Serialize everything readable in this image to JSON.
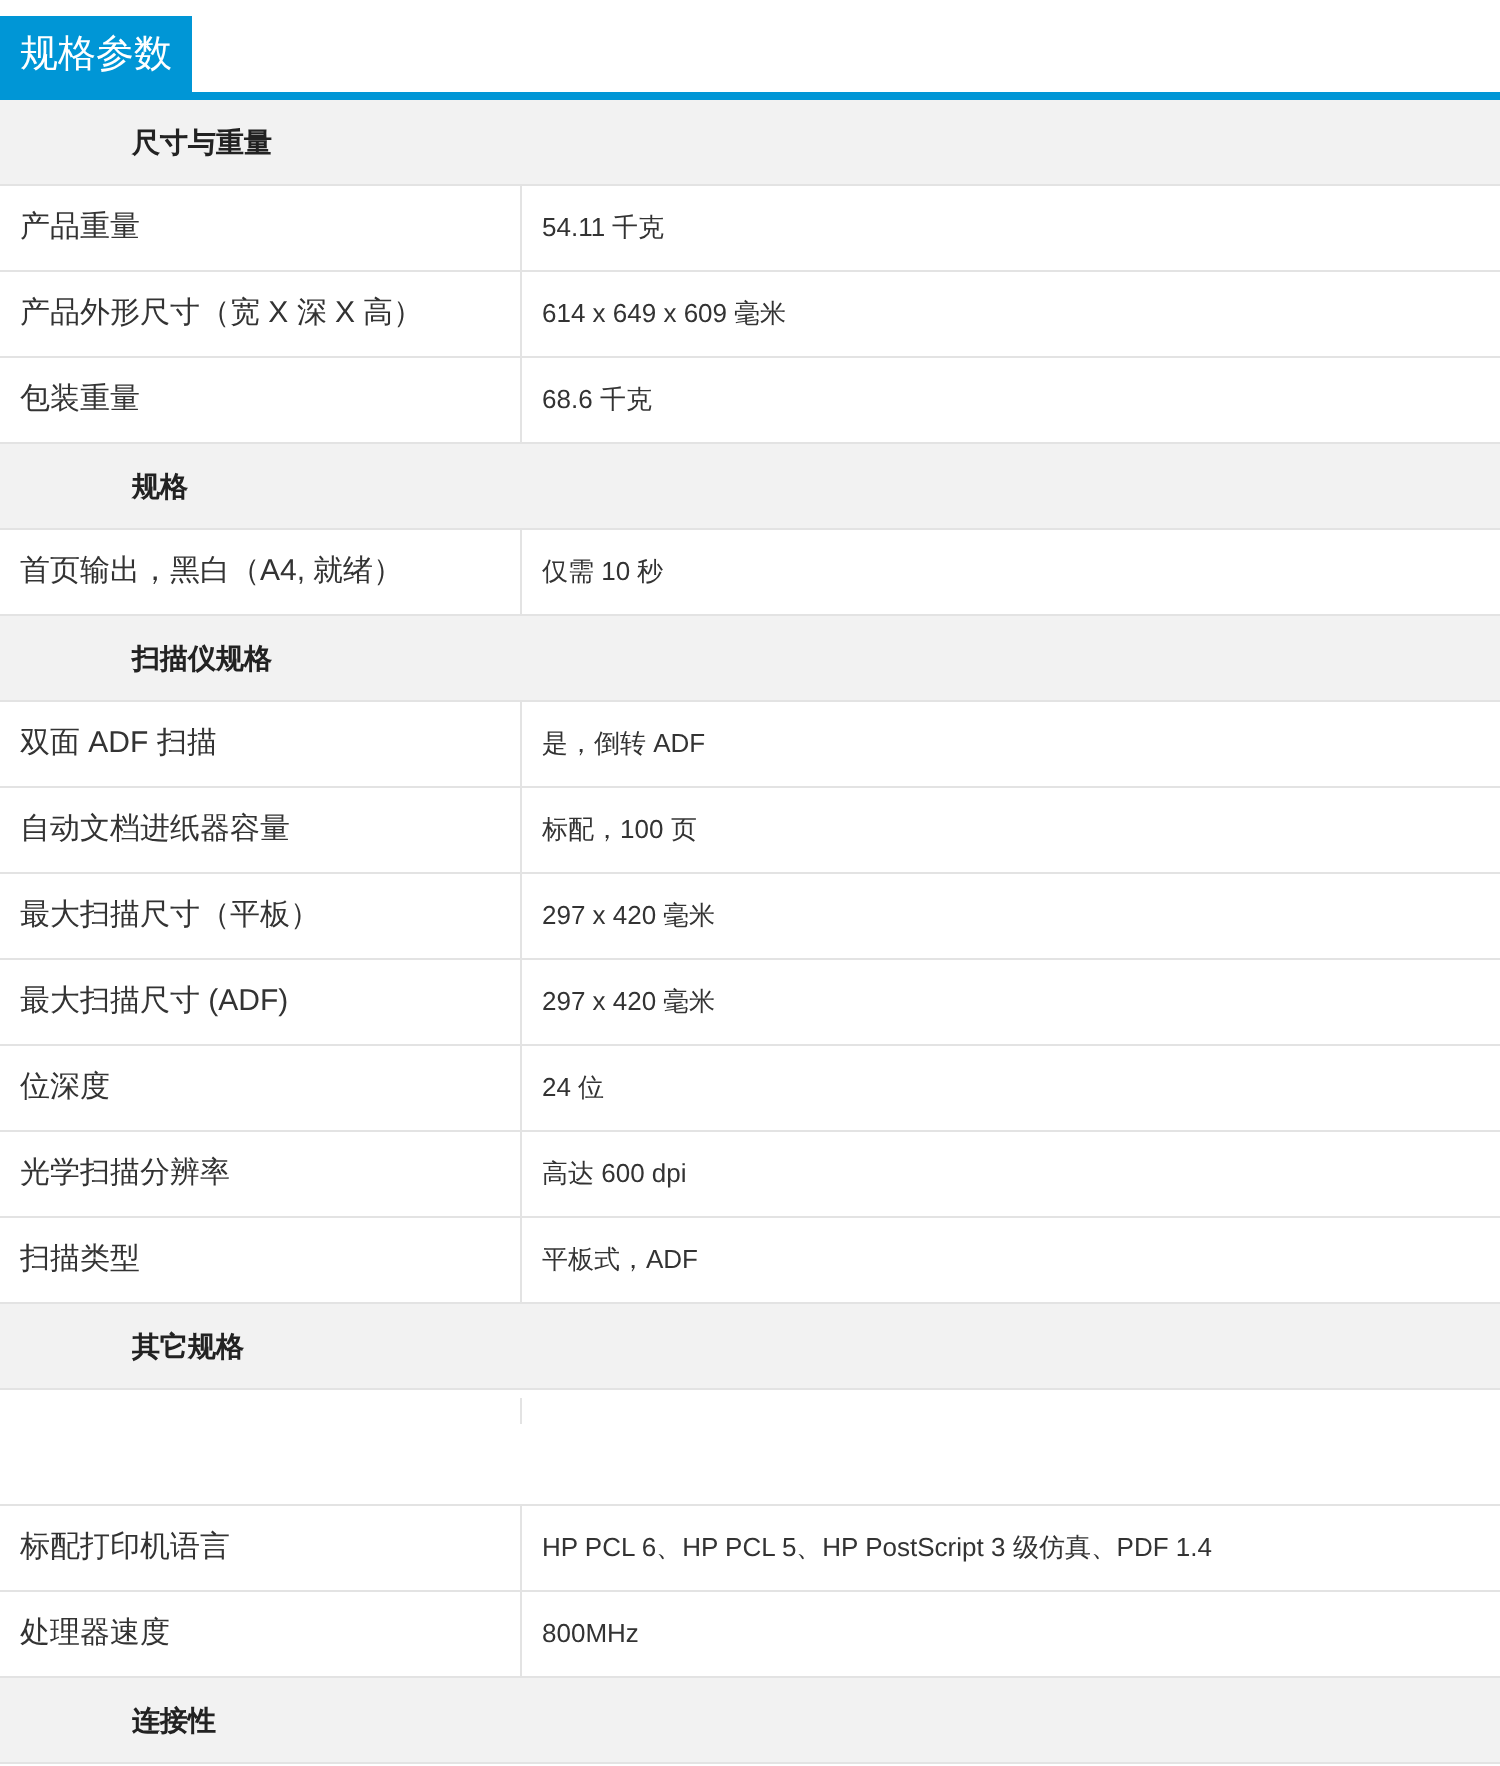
{
  "tab": {
    "label": "规格参数",
    "selected": true
  },
  "sections": [
    {
      "title": "尺寸与重量",
      "rows": [
        {
          "kind": "spec",
          "label": "产品重量",
          "value": "54.11 千克"
        },
        {
          "kind": "spec",
          "label": "产品外形尺寸（宽 X 深 X 高）",
          "value": "614 x 649 x 609 毫米"
        },
        {
          "kind": "spec",
          "label": "包装重量",
          "value": "68.6 千克"
        }
      ]
    },
    {
      "title": "规格",
      "rows": [
        {
          "kind": "spec",
          "label": "首页输出，黑白（A4, 就绪）",
          "value": "仅需 10 秒"
        }
      ]
    },
    {
      "title": "扫描仪规格",
      "rows": [
        {
          "kind": "spec",
          "label": "双面 ADF 扫描",
          "value": "是，倒转 ADF"
        },
        {
          "kind": "spec",
          "label": "自动文档进纸器容量",
          "value": "标配，100 页"
        },
        {
          "kind": "spec",
          "label": "最大扫描尺寸（平板）",
          "value": "297 x 420 毫米"
        },
        {
          "kind": "spec",
          "label": "最大扫描尺寸 (ADF)",
          "value": "297 x 420 毫米"
        },
        {
          "kind": "spec",
          "label": "位深度",
          "value": "24 位"
        },
        {
          "kind": "spec",
          "label": "光学扫描分辨率",
          "value": "高达 600 dpi"
        },
        {
          "kind": "spec",
          "label": "扫描类型",
          "value": "平板式，ADF"
        }
      ]
    },
    {
      "title": "其它规格",
      "rows": [
        {
          "kind": "blank"
        },
        {
          "kind": "spec",
          "label": "标配打印机语言",
          "value": "HP PCL 6、HP PCL 5、HP PostScript 3 级仿真、PDF 1.4"
        },
        {
          "kind": "spec",
          "label": "处理器速度",
          "value": "800MHz"
        }
      ]
    },
    {
      "title": "连接性"
    }
  ]
}
